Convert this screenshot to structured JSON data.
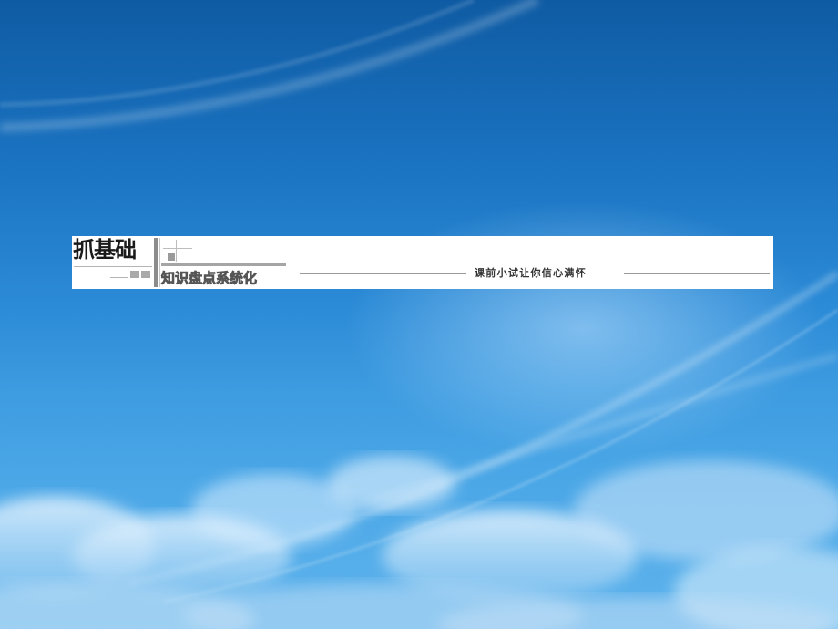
{
  "banner": {
    "title": "抓基础",
    "subtitle": "知识盘点系统化",
    "slogan": "课前小试让你信心满怀"
  },
  "colors": {
    "sky_top": "#0f5ba3",
    "sky_bottom": "#5eb3ec",
    "banner_background": "#ffffff",
    "title_text": "#1a1a1a",
    "rule_gray": "#9a9a9a"
  }
}
